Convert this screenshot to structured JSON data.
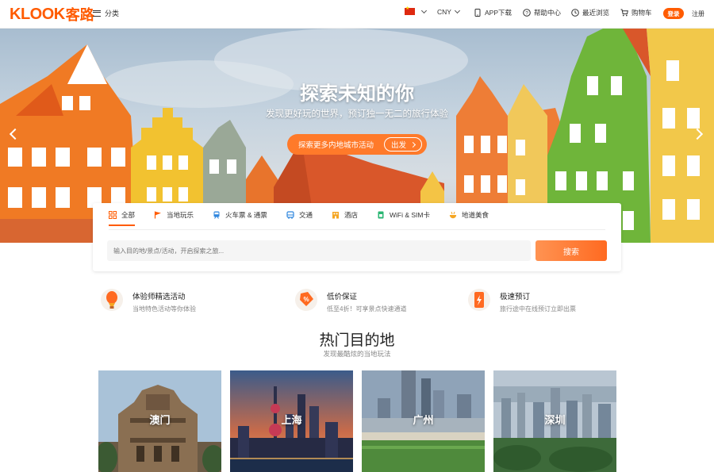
{
  "header": {
    "logo_text": "KLOOK",
    "logo_cn": "客路",
    "category_label": "分类",
    "currency": "CNY",
    "app_download": "APP下载",
    "help_center": "帮助中心",
    "recent": "最近浏览",
    "cart": "购物车",
    "login": "登录",
    "register": "注册"
  },
  "hero": {
    "title": "探索未知的你",
    "subtitle": "发现更好玩的世界，预订独一无二的旅行体验",
    "cta_label": "探索更多内地城市活动",
    "cta_go": "出发"
  },
  "search": {
    "tabs": [
      {
        "label": "全部",
        "icon": "grid-icon",
        "color": "#ff5b00"
      },
      {
        "label": "当地玩乐",
        "icon": "flag-icon",
        "color": "#ff5b00"
      },
      {
        "label": "火车票 & 通票",
        "icon": "train-icon",
        "color": "#2e86de"
      },
      {
        "label": "交通",
        "icon": "bus-icon",
        "color": "#2e86de"
      },
      {
        "label": "酒店",
        "icon": "hotel-icon",
        "color": "#f5a623"
      },
      {
        "label": "WiFi & SIM卡",
        "icon": "wifi-icon",
        "color": "#2bb673"
      },
      {
        "label": "地道美食",
        "icon": "food-icon",
        "color": "#f5a623"
      }
    ],
    "placeholder": "输入目的地/景点/活动，开启探索之旅...",
    "button": "搜索"
  },
  "features": [
    {
      "title": "体验师精选活动",
      "desc": "当地特色活动等你体验",
      "icon": "balloon-icon"
    },
    {
      "title": "低价保证",
      "desc": "低至4折！可享景点快速通道",
      "icon": "price-tag-icon"
    },
    {
      "title": "极速预订",
      "desc": "旅行途中在线预订立即出票",
      "icon": "phone-lightning-icon"
    }
  ],
  "destinations": {
    "title": "热门目的地",
    "subtitle": "发现最酷炫的当地玩法",
    "items": [
      {
        "name": "澳门"
      },
      {
        "name": "上海"
      },
      {
        "name": "广州"
      },
      {
        "name": "深圳"
      }
    ]
  },
  "colors": {
    "brand": "#ff5b00"
  }
}
